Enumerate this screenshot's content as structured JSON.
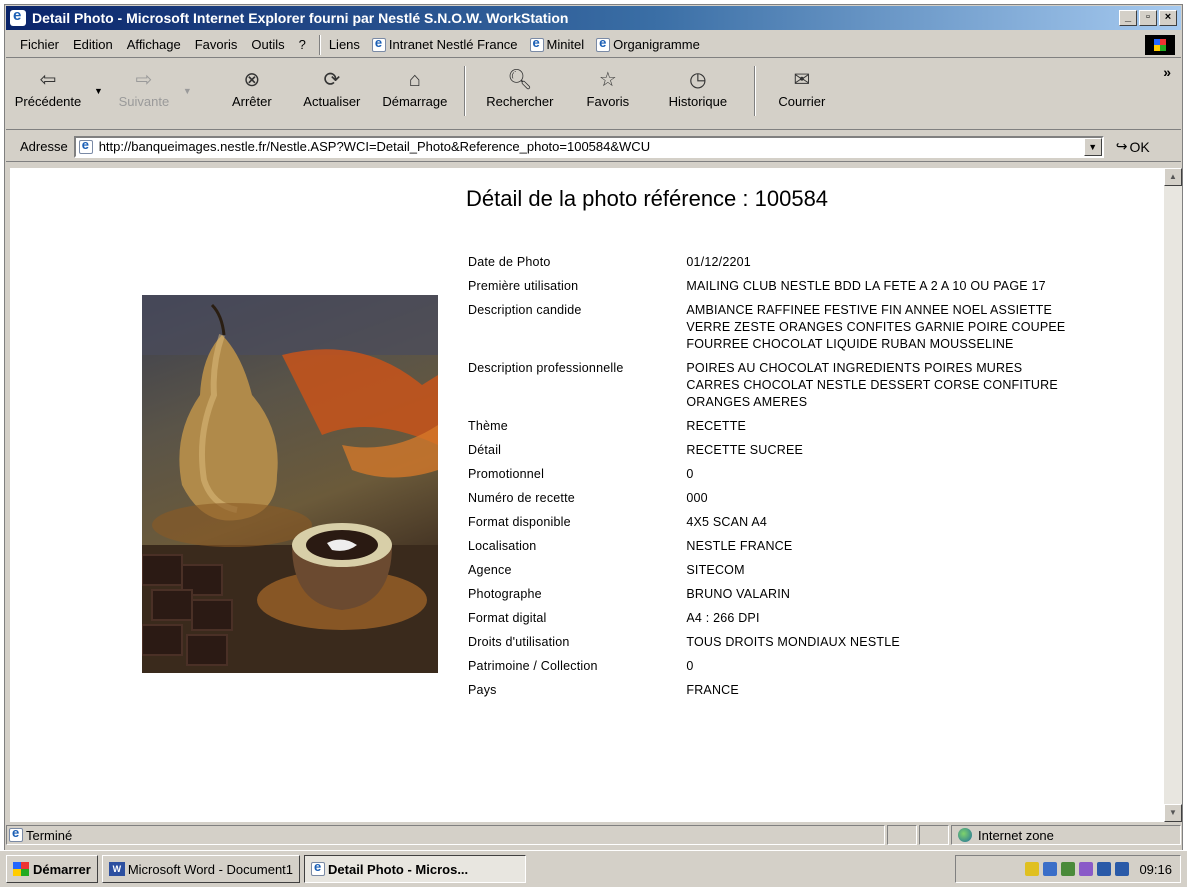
{
  "window": {
    "title": "Detail Photo - Microsoft Internet Explorer fourni par Nestlé S.N.O.W. WorkStation",
    "min_label": "_",
    "max_label": "▫",
    "close_label": "×"
  },
  "menu": {
    "items": [
      "Fichier",
      "Edition",
      "Affichage",
      "Favoris",
      "Outils",
      "?"
    ],
    "links_label": "Liens",
    "links": [
      "Intranet Nestlé France",
      "Minitel",
      "Organigramme"
    ]
  },
  "toolbar": {
    "buttons": [
      "Précédente",
      "Suivante",
      "Arrêter",
      "Actualiser",
      "Démarrage",
      "Rechercher",
      "Favoris",
      "Historique",
      "Courrier"
    ],
    "more": "»"
  },
  "address": {
    "label": "Adresse",
    "url": "http://banqueimages.nestle.fr/Nestle.ASP?WCI=Detail_Photo&Reference_photo=100584&WCU",
    "go_label": "OK"
  },
  "page": {
    "heading": "Détail de la photo référence : 100584",
    "details": [
      {
        "label": "Date de Photo",
        "value": "01/12/2201"
      },
      {
        "label": "Première utilisation",
        "value": "MAILING CLUB NESTLE BDD LA FETE A 2 A 10 OU PAGE 17"
      },
      {
        "label": "Description candide",
        "value": "AMBIANCE RAFFINEE FESTIVE FIN ANNEE NOEL ASSIETTE VERRE ZESTE ORANGES CONFITES GARNIE POIRE COUPEE FOURREE CHOCOLAT LIQUIDE RUBAN MOUSSELINE"
      },
      {
        "label": "Description professionnelle",
        "value": "POIRES AU CHOCOLAT INGREDIENTS POIRES MURES CARRES CHOCOLAT NESTLE DESSERT CORSE CONFITURE ORANGES AMERES"
      },
      {
        "label": "Thème",
        "value": "RECETTE"
      },
      {
        "label": "Détail",
        "value": "RECETTE SUCREE"
      },
      {
        "label": "Promotionnel",
        "value": "0"
      },
      {
        "label": "Numéro de recette",
        "value": "000"
      },
      {
        "label": "Format disponible",
        "value": "4X5 SCAN A4"
      },
      {
        "label": "Localisation",
        "value": "NESTLE FRANCE"
      },
      {
        "label": "Agence",
        "value": "SITECOM"
      },
      {
        "label": "Photographe",
        "value": "BRUNO VALARIN"
      },
      {
        "label": "Format digital",
        "value": "A4 : 266 DPI"
      },
      {
        "label": "Droits d'utilisation",
        "value": "TOUS DROITS MONDIAUX NESTLE"
      },
      {
        "label": "Patrimoine / Collection",
        "value": "0"
      },
      {
        "label": "Pays",
        "value": "FRANCE"
      }
    ]
  },
  "status": {
    "text": "Terminé",
    "zone": "Internet zone"
  },
  "taskbar": {
    "start": "Démarrer",
    "tasks": [
      "Microsoft Word - Document1",
      "Detail Photo - Micros..."
    ],
    "clock": "09:16"
  }
}
